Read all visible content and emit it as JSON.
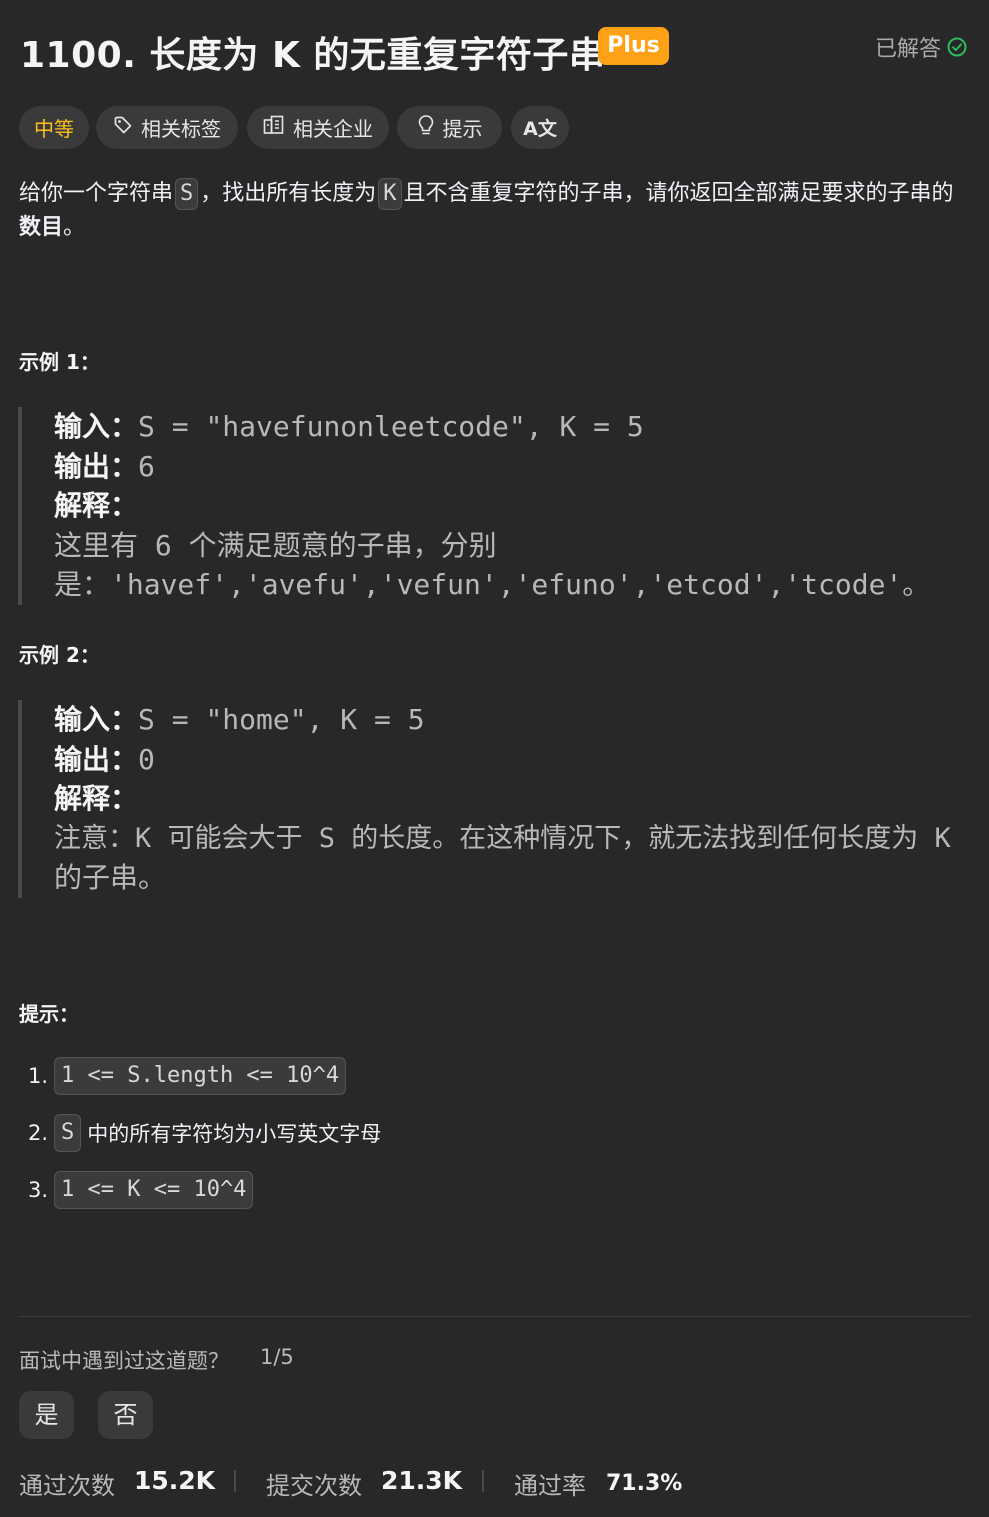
{
  "header": {
    "title": "1100. 长度为 K 的无重复字符子串",
    "plus_badge": "Plus",
    "solved_label": "已解答",
    "solved_icon": "check-circle-icon",
    "solved_color": "#2cbb5d"
  },
  "tags": {
    "difficulty": "中等",
    "difficulty_color": "#ffc01e",
    "topics": "相关标签",
    "companies": "相关企业",
    "hint": "提示",
    "translate": "A文"
  },
  "description": {
    "part1": "给你一个字符串",
    "code_s": "S",
    "part2": "，找出所有长度为",
    "code_k": "K",
    "part3": "且不含重复字符的子串，请你返回全部满足要求的子串的",
    "bold": "数目",
    "end": "。"
  },
  "examples": [
    {
      "title": "示例 1：",
      "input_label": "输入：",
      "input_value": "S = \"havefunonleetcode\", K = 5",
      "output_label": "输出：",
      "output_value": "6",
      "explain_label": "解释：",
      "explain_line1": "这里有 6 个满足题意的子串，分别",
      "explain_line2": "是：'havef','avefu','vefun','efuno','etcod','tcode'。"
    },
    {
      "title": "示例 2：",
      "input_label": "输入：",
      "input_value": "S = \"home\", K = 5",
      "output_label": "输出：",
      "output_value": "0",
      "explain_label": "解释：",
      "explain_line1": "注意：K 可能会大于 S 的长度。在这种情况下，就无法找到任何长度为 K",
      "explain_line2": "的子串。"
    }
  ],
  "constraints": {
    "title": "提示：",
    "items": [
      {
        "num": "1.",
        "code": "1 <= S.length <= 10^4",
        "text": ""
      },
      {
        "num": "2.",
        "code": "S",
        "text": "中的所有字符均为小写英文字母"
      },
      {
        "num": "3.",
        "code": "1 <= K <= 10^4",
        "text": ""
      }
    ]
  },
  "interview": {
    "question": "面试中遇到过这道题？",
    "count": "1/5",
    "yes": "是",
    "no": "否"
  },
  "stats": {
    "accepted_label": "通过次数",
    "accepted_value": "15.2K",
    "submissions_label": "提交次数",
    "submissions_value": "21.3K",
    "rate_label": "通过率",
    "rate_value": "71.3%"
  }
}
